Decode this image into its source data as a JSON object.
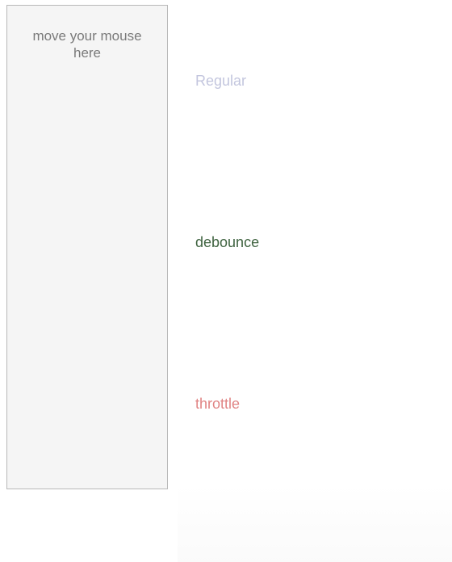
{
  "hover_area": {
    "label": "move your mouse here"
  },
  "tracks": {
    "regular": {
      "label": "Regular",
      "color": "#c3c6de"
    },
    "debounce": {
      "label": "debounce",
      "color": "#3f6340"
    },
    "throttle": {
      "label": "throttle",
      "color": "#e08484"
    }
  }
}
